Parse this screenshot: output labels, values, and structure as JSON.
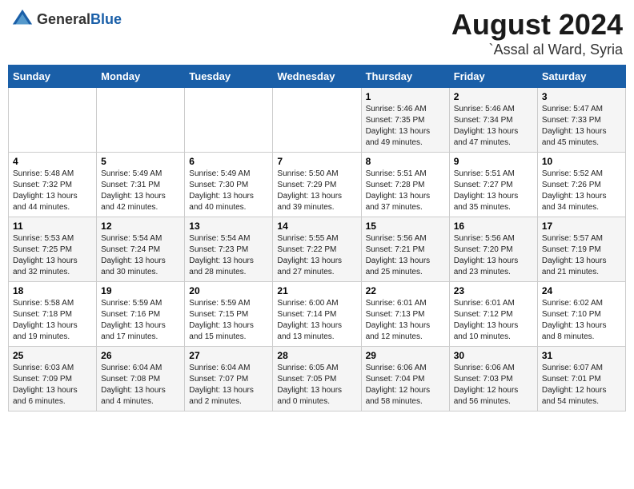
{
  "header": {
    "logo_general": "General",
    "logo_blue": "Blue",
    "main_title": "August 2024",
    "sub_title": "`Assal al Ward, Syria"
  },
  "calendar": {
    "weekdays": [
      "Sunday",
      "Monday",
      "Tuesday",
      "Wednesday",
      "Thursday",
      "Friday",
      "Saturday"
    ],
    "weeks": [
      [
        {
          "day": "",
          "info": ""
        },
        {
          "day": "",
          "info": ""
        },
        {
          "day": "",
          "info": ""
        },
        {
          "day": "",
          "info": ""
        },
        {
          "day": "1",
          "info": "Sunrise: 5:46 AM\nSunset: 7:35 PM\nDaylight: 13 hours\nand 49 minutes."
        },
        {
          "day": "2",
          "info": "Sunrise: 5:46 AM\nSunset: 7:34 PM\nDaylight: 13 hours\nand 47 minutes."
        },
        {
          "day": "3",
          "info": "Sunrise: 5:47 AM\nSunset: 7:33 PM\nDaylight: 13 hours\nand 45 minutes."
        }
      ],
      [
        {
          "day": "4",
          "info": "Sunrise: 5:48 AM\nSunset: 7:32 PM\nDaylight: 13 hours\nand 44 minutes."
        },
        {
          "day": "5",
          "info": "Sunrise: 5:49 AM\nSunset: 7:31 PM\nDaylight: 13 hours\nand 42 minutes."
        },
        {
          "day": "6",
          "info": "Sunrise: 5:49 AM\nSunset: 7:30 PM\nDaylight: 13 hours\nand 40 minutes."
        },
        {
          "day": "7",
          "info": "Sunrise: 5:50 AM\nSunset: 7:29 PM\nDaylight: 13 hours\nand 39 minutes."
        },
        {
          "day": "8",
          "info": "Sunrise: 5:51 AM\nSunset: 7:28 PM\nDaylight: 13 hours\nand 37 minutes."
        },
        {
          "day": "9",
          "info": "Sunrise: 5:51 AM\nSunset: 7:27 PM\nDaylight: 13 hours\nand 35 minutes."
        },
        {
          "day": "10",
          "info": "Sunrise: 5:52 AM\nSunset: 7:26 PM\nDaylight: 13 hours\nand 34 minutes."
        }
      ],
      [
        {
          "day": "11",
          "info": "Sunrise: 5:53 AM\nSunset: 7:25 PM\nDaylight: 13 hours\nand 32 minutes."
        },
        {
          "day": "12",
          "info": "Sunrise: 5:54 AM\nSunset: 7:24 PM\nDaylight: 13 hours\nand 30 minutes."
        },
        {
          "day": "13",
          "info": "Sunrise: 5:54 AM\nSunset: 7:23 PM\nDaylight: 13 hours\nand 28 minutes."
        },
        {
          "day": "14",
          "info": "Sunrise: 5:55 AM\nSunset: 7:22 PM\nDaylight: 13 hours\nand 27 minutes."
        },
        {
          "day": "15",
          "info": "Sunrise: 5:56 AM\nSunset: 7:21 PM\nDaylight: 13 hours\nand 25 minutes."
        },
        {
          "day": "16",
          "info": "Sunrise: 5:56 AM\nSunset: 7:20 PM\nDaylight: 13 hours\nand 23 minutes."
        },
        {
          "day": "17",
          "info": "Sunrise: 5:57 AM\nSunset: 7:19 PM\nDaylight: 13 hours\nand 21 minutes."
        }
      ],
      [
        {
          "day": "18",
          "info": "Sunrise: 5:58 AM\nSunset: 7:18 PM\nDaylight: 13 hours\nand 19 minutes."
        },
        {
          "day": "19",
          "info": "Sunrise: 5:59 AM\nSunset: 7:16 PM\nDaylight: 13 hours\nand 17 minutes."
        },
        {
          "day": "20",
          "info": "Sunrise: 5:59 AM\nSunset: 7:15 PM\nDaylight: 13 hours\nand 15 minutes."
        },
        {
          "day": "21",
          "info": "Sunrise: 6:00 AM\nSunset: 7:14 PM\nDaylight: 13 hours\nand 13 minutes."
        },
        {
          "day": "22",
          "info": "Sunrise: 6:01 AM\nSunset: 7:13 PM\nDaylight: 13 hours\nand 12 minutes."
        },
        {
          "day": "23",
          "info": "Sunrise: 6:01 AM\nSunset: 7:12 PM\nDaylight: 13 hours\nand 10 minutes."
        },
        {
          "day": "24",
          "info": "Sunrise: 6:02 AM\nSunset: 7:10 PM\nDaylight: 13 hours\nand 8 minutes."
        }
      ],
      [
        {
          "day": "25",
          "info": "Sunrise: 6:03 AM\nSunset: 7:09 PM\nDaylight: 13 hours\nand 6 minutes."
        },
        {
          "day": "26",
          "info": "Sunrise: 6:04 AM\nSunset: 7:08 PM\nDaylight: 13 hours\nand 4 minutes."
        },
        {
          "day": "27",
          "info": "Sunrise: 6:04 AM\nSunset: 7:07 PM\nDaylight: 13 hours\nand 2 minutes."
        },
        {
          "day": "28",
          "info": "Sunrise: 6:05 AM\nSunset: 7:05 PM\nDaylight: 13 hours\nand 0 minutes."
        },
        {
          "day": "29",
          "info": "Sunrise: 6:06 AM\nSunset: 7:04 PM\nDaylight: 12 hours\nand 58 minutes."
        },
        {
          "day": "30",
          "info": "Sunrise: 6:06 AM\nSunset: 7:03 PM\nDaylight: 12 hours\nand 56 minutes."
        },
        {
          "day": "31",
          "info": "Sunrise: 6:07 AM\nSunset: 7:01 PM\nDaylight: 12 hours\nand 54 minutes."
        }
      ]
    ]
  }
}
